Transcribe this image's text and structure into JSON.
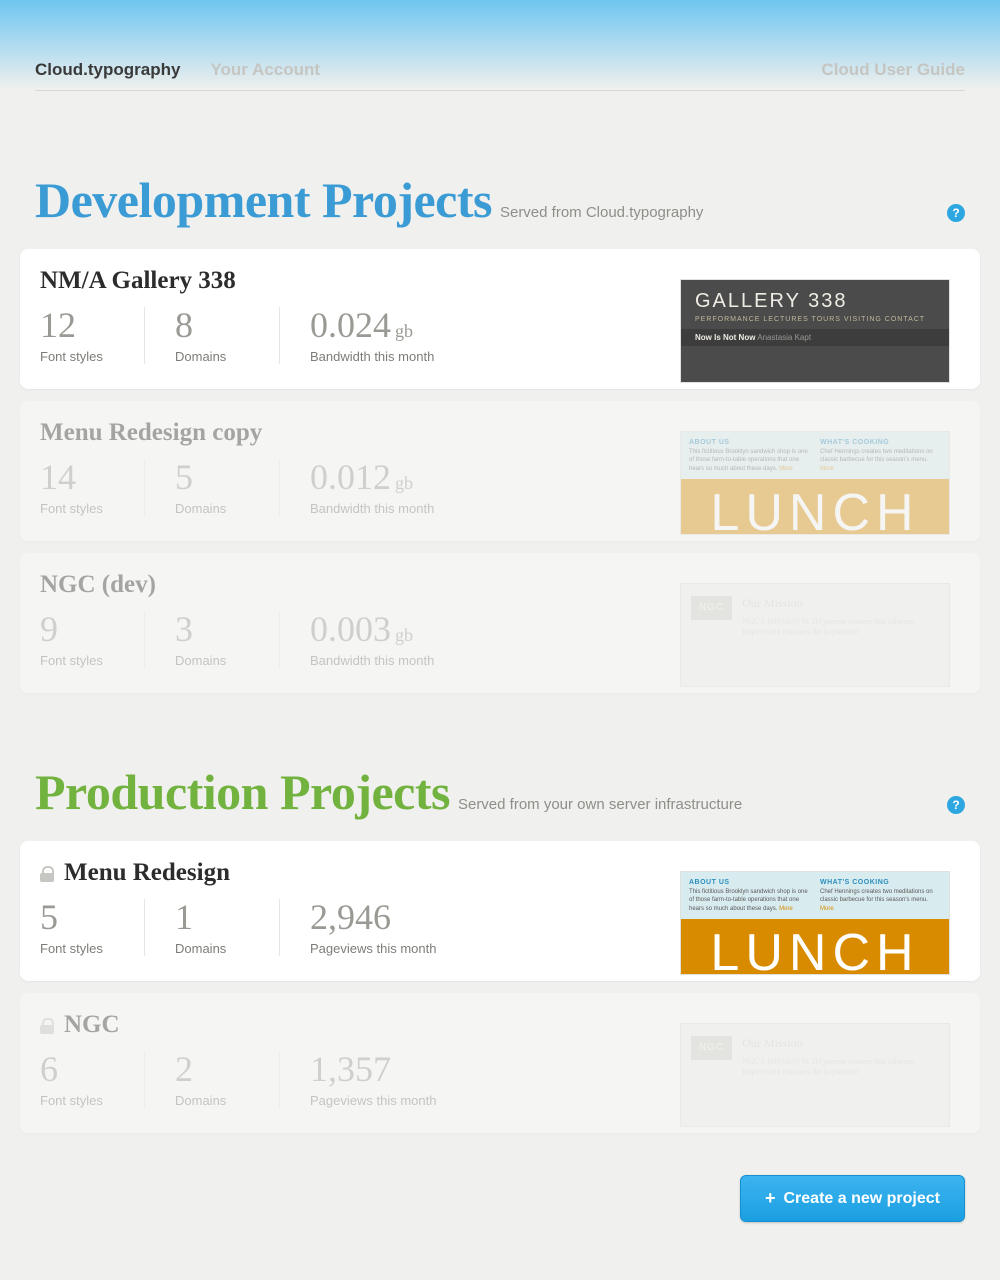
{
  "nav": {
    "brand": "Cloud.typography",
    "account": "Your Account",
    "guide": "Cloud User Guide"
  },
  "sections": {
    "dev": {
      "title": "Development Projects",
      "subtitle": "Served from Cloud.typography"
    },
    "prod": {
      "title": "Production Projects",
      "subtitle": "Served from your own server infrastructure"
    }
  },
  "labels": {
    "font_styles": "Font styles",
    "domains": "Domains",
    "bandwidth": "Bandwidth this month",
    "pageviews": "Pageviews this month",
    "gb": "gb"
  },
  "dev_projects": [
    {
      "name": "NM/A Gallery 338",
      "fonts": "12",
      "domains": "8",
      "bandwidth": "0.024",
      "preview": "gallery"
    },
    {
      "name": "Menu Redesign copy",
      "fonts": "14",
      "domains": "5",
      "bandwidth": "0.012",
      "preview": "lunch"
    },
    {
      "name": "NGC (dev)",
      "fonts": "9",
      "domains": "3",
      "bandwidth": "0.003",
      "preview": "ngc"
    }
  ],
  "prod_projects": [
    {
      "name": "Menu Redesign",
      "fonts": "5",
      "domains": "1",
      "pageviews": "2,946",
      "preview": "lunch"
    },
    {
      "name": "NGC",
      "fonts": "6",
      "domains": "2",
      "pageviews": "1,357",
      "preview": "ngc"
    }
  ],
  "previews": {
    "gallery": {
      "title": "GALLERY 338",
      "tags": "PERFORMANCE  LECTURES  TOURS  VISITING  CONTACT",
      "now": "Now Is Not Now",
      "sub": "Anastasia Kapt"
    },
    "lunch": {
      "h1": "ABOUT US",
      "t1": "This fictitious Brooklyn sandwich shop is one of those farm-to-table operations that one hears so much about these days.",
      "m1": "More",
      "h2": "WHAT'S COOKING",
      "t2": "Chef Hennings creates two meditations on classic barbecue for this season's menu.",
      "m2": "More",
      "big": "LUNCH"
    },
    "ngc": {
      "side": "NGC",
      "head": "Our Mission",
      "body": "NGC'S MISSION IS TO present content that informs, inspires and educates the population"
    }
  },
  "cta": "Create a new project"
}
